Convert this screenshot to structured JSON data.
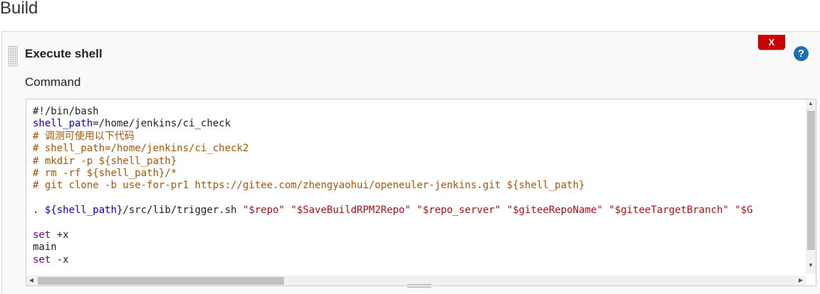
{
  "section": {
    "title": "Build"
  },
  "step": {
    "title": "Execute shell",
    "delete_label": "X",
    "help_label": "?",
    "command_label": "Command"
  },
  "code_lines": [
    [
      {
        "t": "#!/bin/bash",
        "c": ""
      }
    ],
    [
      {
        "t": "shell_path",
        "c": "var"
      },
      {
        "t": "=/home/jenkins/ci_check",
        "c": ""
      }
    ],
    [
      {
        "t": "# 调测可使用以下代码",
        "c": "comment"
      }
    ],
    [
      {
        "t": "# shell_path=/home/jenkins/ci_check2",
        "c": "comment"
      }
    ],
    [
      {
        "t": "# mkdir -p ${shell_path}",
        "c": "comment"
      }
    ],
    [
      {
        "t": "# rm -rf ${shell_path}/*",
        "c": "comment"
      }
    ],
    [
      {
        "t": "# git clone -b use-for-pr1 https://gitee.com/zhengyaohui/openeuler-jenkins.git ${shell_path}",
        "c": "comment"
      }
    ],
    [
      {
        "t": "",
        "c": ""
      }
    ],
    [
      {
        "t": ". ",
        "c": ""
      },
      {
        "t": "${shell_path}",
        "c": "var"
      },
      {
        "t": "/src/lib/trigger.sh ",
        "c": ""
      },
      {
        "t": "\"$repo\"",
        "c": "str"
      },
      {
        "t": " ",
        "c": ""
      },
      {
        "t": "\"$SaveBuildRPM2Repo\"",
        "c": "str"
      },
      {
        "t": " ",
        "c": ""
      },
      {
        "t": "\"$repo_server\"",
        "c": "str"
      },
      {
        "t": " ",
        "c": ""
      },
      {
        "t": "\"$giteeRepoName\"",
        "c": "str"
      },
      {
        "t": " ",
        "c": ""
      },
      {
        "t": "\"$giteeTargetBranch\"",
        "c": "str"
      },
      {
        "t": " ",
        "c": ""
      },
      {
        "t": "\"$G",
        "c": "str"
      }
    ],
    [
      {
        "t": "",
        "c": ""
      }
    ],
    [
      {
        "t": "set",
        "c": "kw"
      },
      {
        "t": " +x",
        "c": ""
      }
    ],
    [
      {
        "t": "main",
        "c": ""
      }
    ],
    [
      {
        "t": "set",
        "c": "kw"
      },
      {
        "t": " -x",
        "c": ""
      }
    ]
  ],
  "colors": {
    "delete": "#cc0000",
    "help": "#1c6fb3",
    "variable": "#0000cc",
    "comment": "#aa5500",
    "string": "#aa1111",
    "keyword": "#770088"
  },
  "icons": {
    "delete": "close-icon",
    "help": "help-icon",
    "scroll_up": "arrow-up-icon",
    "scroll_down": "arrow-down-icon",
    "scroll_left": "arrow-left-icon",
    "scroll_right": "arrow-right-icon"
  }
}
